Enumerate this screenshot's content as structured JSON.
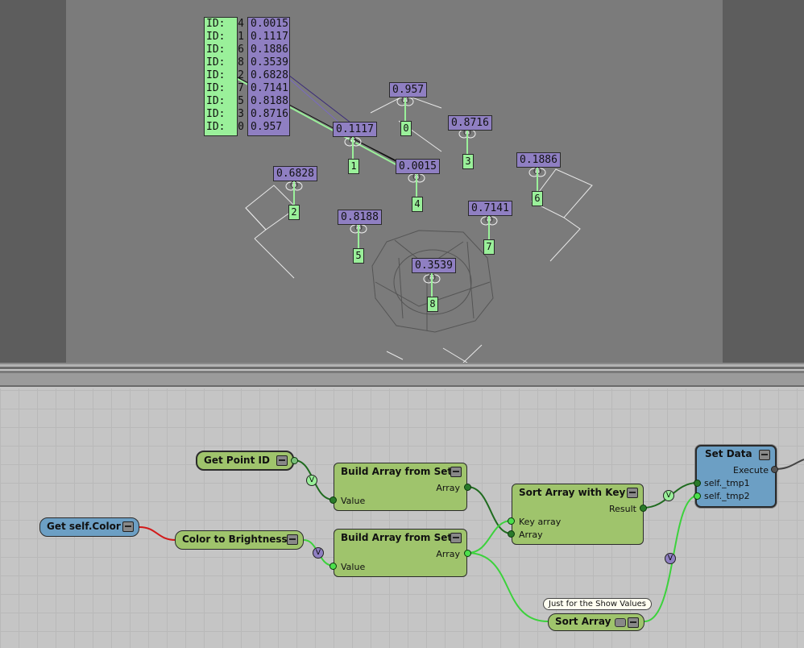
{
  "viewport": {
    "id_list": [
      "ID:  4",
      "ID:  1",
      "ID:  6",
      "ID:  8",
      "ID:  2",
      "ID:  7",
      "ID:  5",
      "ID:  3",
      "ID:  0"
    ],
    "value_list": [
      "0.0015",
      "0.1117",
      "0.1886",
      "0.3539",
      "0.6828",
      "0.7141",
      "0.8188",
      "0.8716",
      "0.957"
    ],
    "points": [
      {
        "id": "0",
        "value": "0.957"
      },
      {
        "id": "1",
        "value": "0.1117"
      },
      {
        "id": "2",
        "value": "0.6828"
      },
      {
        "id": "3",
        "value": "0.8716"
      },
      {
        "id": "4",
        "value": "0.0015"
      },
      {
        "id": "5",
        "value": "0.8188"
      },
      {
        "id": "6",
        "value": "0.1886"
      },
      {
        "id": "7",
        "value": "0.7141"
      },
      {
        "id": "8",
        "value": "0.3539"
      }
    ]
  },
  "graph": {
    "nodes": {
      "get_point_id": {
        "title": "Get Point ID"
      },
      "get_self_color": {
        "title": "Get self.Color"
      },
      "color_to_brightness": {
        "title": "Color to Brightness"
      },
      "build_array_1": {
        "title": "Build Array from Set",
        "out": "Array",
        "in": "Value"
      },
      "build_array_2": {
        "title": "Build Array from Set",
        "out": "Array",
        "in": "Value"
      },
      "sort_with_key": {
        "title": "Sort Array with Key",
        "in1": "Key array",
        "in2": "Array",
        "out": "Result"
      },
      "sort_array": {
        "title": "Sort Array"
      },
      "set_data": {
        "title": "Set Data",
        "execute": "Execute",
        "in1": "self._tmp1",
        "in2": "self._tmp2"
      }
    },
    "tooltip": "Just for the Show Values",
    "badge": "V"
  },
  "colors": {
    "id_label": "#9af09a",
    "value_label": "#8f7fc2",
    "node_green": "#9fc46c",
    "node_blue": "#6c9fc4"
  }
}
